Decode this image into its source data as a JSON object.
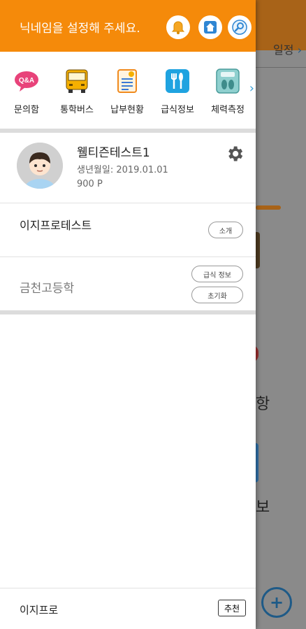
{
  "header": {
    "title": "닉네임을 설정해 주세요.",
    "icons": [
      "bell-icon",
      "home-icon",
      "settings-search-icon"
    ]
  },
  "menu": {
    "items": [
      {
        "label": "문의함",
        "icon": "qna-icon"
      },
      {
        "label": "통학버스",
        "icon": "bus-icon"
      },
      {
        "label": "납부현황",
        "icon": "payment-icon"
      },
      {
        "label": "급식정보",
        "icon": "meal-icon"
      },
      {
        "label": "체력측정",
        "icon": "fitness-icon"
      }
    ]
  },
  "profile": {
    "name": "웰티즌테스트1",
    "birth": "생년월일: 2019.01.01",
    "points": "900 P"
  },
  "schools": [
    {
      "name": "이지프로테스트",
      "buttons": [
        "소개"
      ]
    },
    {
      "name": "금천고등학",
      "buttons": [
        "급식 정보",
        "초기화"
      ]
    }
  ],
  "footer": {
    "name": "이지프로",
    "button": "추천"
  },
  "background": {
    "tab_label": "일정",
    "text1": "항",
    "text2": "보"
  },
  "colors": {
    "accent": "#f58a0a",
    "divider": "#dcdcdc"
  }
}
